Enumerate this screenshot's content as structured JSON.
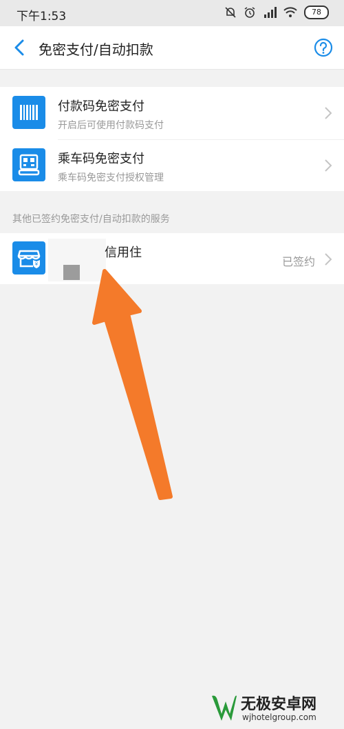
{
  "status_bar": {
    "time": "下午1:53",
    "battery": "78"
  },
  "nav": {
    "title": "免密支付/自动扣款"
  },
  "primary_items": [
    {
      "title": "付款码免密支付",
      "subtitle": "开启后可使用付款码支付"
    },
    {
      "title": "乘车码免密支付",
      "subtitle": "乘车码免密支付授权管理"
    }
  ],
  "section": {
    "label": "其他已签约免密支付/自动扣款的服务"
  },
  "signed_items": [
    {
      "title": "信用住",
      "status": "已签约"
    }
  ],
  "watermark": {
    "title": "无极安卓网",
    "url": "wjhotelgroup.com"
  },
  "colors": {
    "accent": "#1a8ce8",
    "arrow": "#f47a2a",
    "background": "#f2f2f2"
  }
}
